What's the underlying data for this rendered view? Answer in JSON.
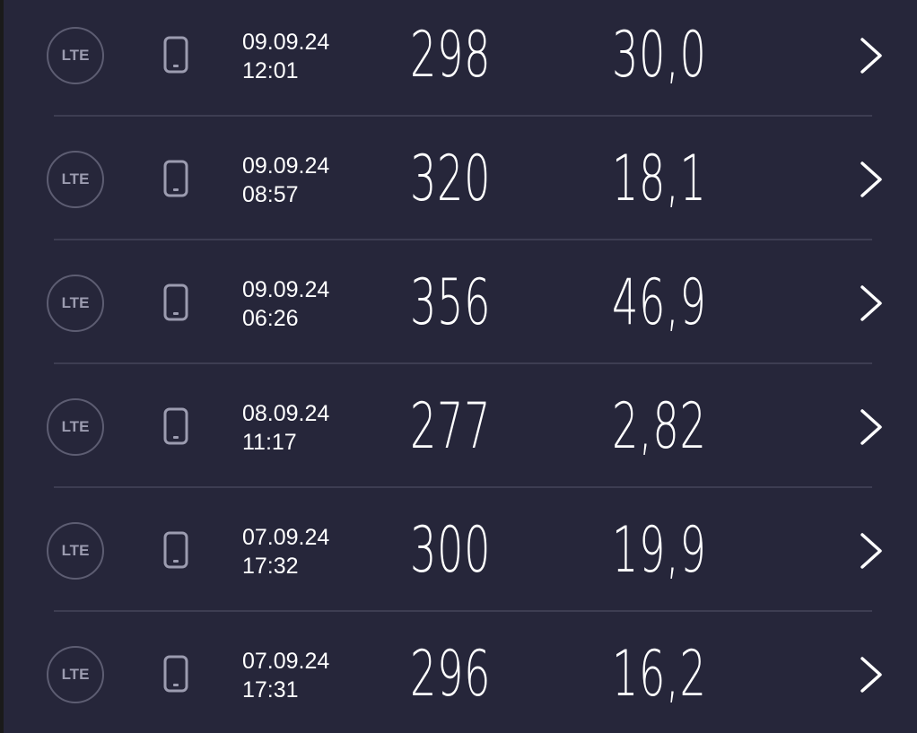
{
  "results": [
    {
      "network": "LTE",
      "device": "phone-icon",
      "date": "09.09.24",
      "time": "12:01",
      "download": "298",
      "upload": "30,0"
    },
    {
      "network": "LTE",
      "device": "phone-icon",
      "date": "09.09.24",
      "time": "08:57",
      "download": "320",
      "upload": "18,1"
    },
    {
      "network": "LTE",
      "device": "phone-icon",
      "date": "09.09.24",
      "time": "06:26",
      "download": "356",
      "upload": "46,9"
    },
    {
      "network": "LTE",
      "device": "phone-icon",
      "date": "08.09.24",
      "time": "11:17",
      "download": "277",
      "upload": "2,82"
    },
    {
      "network": "LTE",
      "device": "phone-icon",
      "date": "07.09.24",
      "time": "17:32",
      "download": "300",
      "upload": "19,9"
    },
    {
      "network": "LTE",
      "device": "phone-icon",
      "date": "07.09.24",
      "time": "17:31",
      "download": "296",
      "upload": "16,2"
    }
  ],
  "colors": {
    "background": "#26263a",
    "divider": "#3d3d52",
    "badge_border": "#5d5d72",
    "badge_text": "#9c9cb0",
    "icon_stroke": "#9c9cb0",
    "text": "#ffffff"
  },
  "icons": {
    "network_badge": "lte-badge-icon",
    "device": "phone-icon",
    "open": "chevron-right-icon"
  }
}
